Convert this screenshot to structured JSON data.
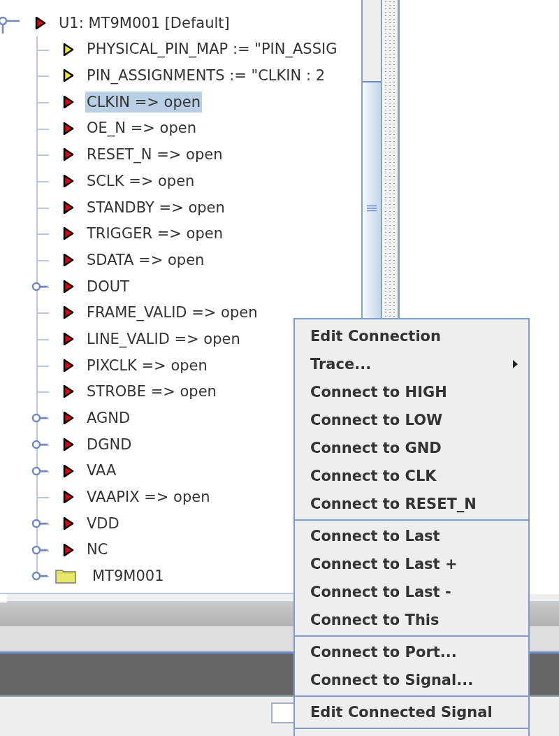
{
  "tree": {
    "root": {
      "label": "U1: MT9M001 [Default]",
      "kind": "port",
      "expanded": true,
      "selected": false,
      "children": [
        {
          "label": "PHYSICAL_PIN_MAP := \"PIN_ASSIG",
          "kind": "generic",
          "expandable": false,
          "selected": false
        },
        {
          "label": "PIN_ASSIGNMENTS := \"CLKIN : 2",
          "kind": "generic",
          "expandable": false,
          "selected": false
        },
        {
          "label": "CLKIN => open",
          "kind": "port",
          "expandable": false,
          "selected": true
        },
        {
          "label": "OE_N => open",
          "kind": "port",
          "expandable": false,
          "selected": false
        },
        {
          "label": "RESET_N => open",
          "kind": "port",
          "expandable": false,
          "selected": false
        },
        {
          "label": "SCLK => open",
          "kind": "port",
          "expandable": false,
          "selected": false
        },
        {
          "label": "STANDBY => open",
          "kind": "port",
          "expandable": false,
          "selected": false
        },
        {
          "label": "TRIGGER => open",
          "kind": "port",
          "expandable": false,
          "selected": false
        },
        {
          "label": "SDATA => open",
          "kind": "port",
          "expandable": false,
          "selected": false
        },
        {
          "label": "DOUT",
          "kind": "port",
          "expandable": true,
          "selected": false
        },
        {
          "label": "FRAME_VALID => open",
          "kind": "port",
          "expandable": false,
          "selected": false
        },
        {
          "label": "LINE_VALID => open",
          "kind": "port",
          "expandable": false,
          "selected": false
        },
        {
          "label": "PIXCLK => open",
          "kind": "port",
          "expandable": false,
          "selected": false
        },
        {
          "label": "STROBE => open",
          "kind": "port",
          "expandable": false,
          "selected": false
        },
        {
          "label": "AGND",
          "kind": "port",
          "expandable": true,
          "selected": false
        },
        {
          "label": "DGND",
          "kind": "port",
          "expandable": true,
          "selected": false
        },
        {
          "label": "VAA",
          "kind": "port",
          "expandable": true,
          "selected": false
        },
        {
          "label": "VAAPIX => open",
          "kind": "port",
          "expandable": false,
          "selected": false
        },
        {
          "label": "VDD",
          "kind": "port",
          "expandable": true,
          "selected": false
        },
        {
          "label": "NC",
          "kind": "port",
          "expandable": true,
          "selected": false
        },
        {
          "label": "MT9M001",
          "kind": "folder",
          "expandable": true,
          "selected": false
        }
      ]
    }
  },
  "context_menu": {
    "sections": [
      [
        {
          "label": "Edit Connection",
          "submenu": false
        },
        {
          "label": "Trace...",
          "submenu": true
        },
        {
          "label": "Connect to HIGH",
          "submenu": false
        },
        {
          "label": "Connect to LOW",
          "submenu": false
        },
        {
          "label": "Connect to GND",
          "submenu": false
        },
        {
          "label": "Connect to CLK",
          "submenu": false
        },
        {
          "label": "Connect to RESET_N",
          "submenu": false
        }
      ],
      [
        {
          "label": "Connect to Last",
          "submenu": false
        },
        {
          "label": "Connect to Last +",
          "submenu": false
        },
        {
          "label": "Connect to Last -",
          "submenu": false
        },
        {
          "label": "Connect to This",
          "submenu": false
        }
      ],
      [
        {
          "label": "Connect to Port...",
          "submenu": false
        },
        {
          "label": "Connect to Signal...",
          "submenu": false
        }
      ],
      [
        {
          "label": "Edit Connected Signal",
          "submenu": false
        }
      ]
    ]
  }
}
